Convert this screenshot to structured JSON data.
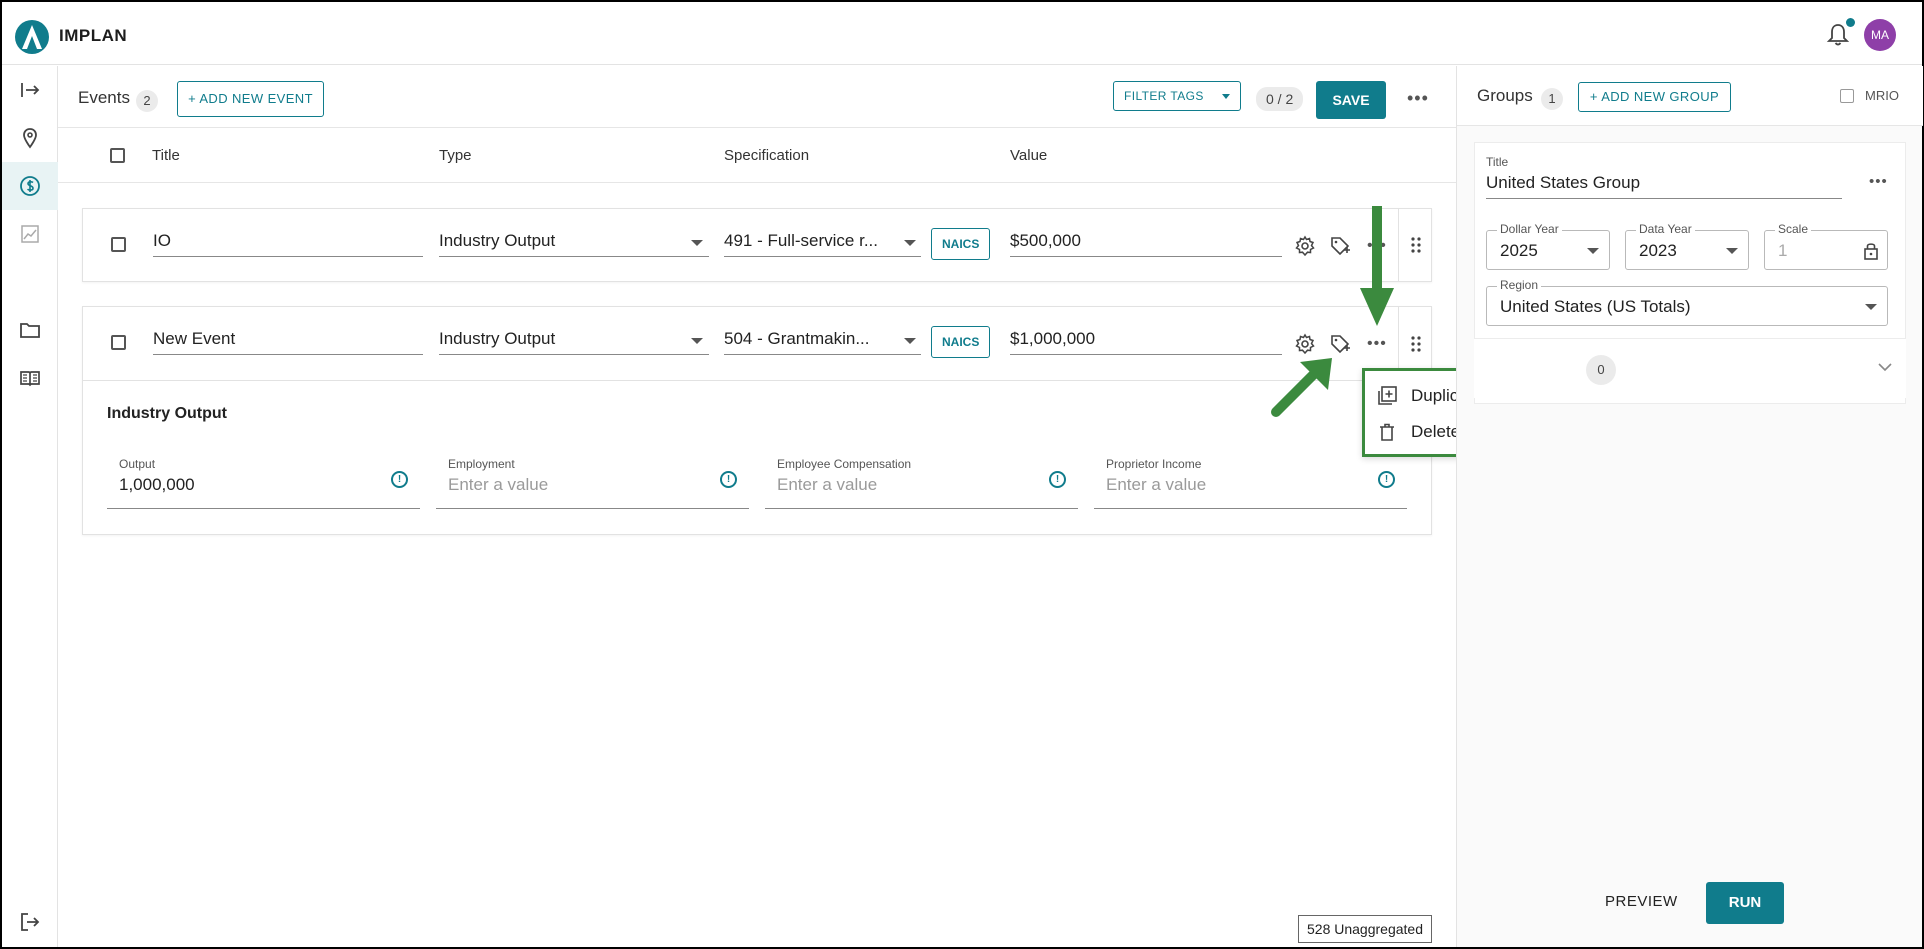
{
  "app": {
    "title": "IMPLAN"
  },
  "user": {
    "initials": "MA"
  },
  "events": {
    "title": "Events",
    "count": "2",
    "add_label": "+ ADD NEW EVENT",
    "filter_tags_label": "FILTER TAGS",
    "selection_count": "0 / 2",
    "save_label": "SAVE",
    "columns": [
      "Title",
      "Type",
      "Specification",
      "Value"
    ],
    "rows": [
      {
        "title": "IO",
        "type": "Industry Output",
        "specification": "491 - Full-service r...",
        "naics": "NAICS",
        "value": "$500,000"
      },
      {
        "title": "New Event",
        "type": "Industry Output",
        "specification": "504 - Grantmakin...",
        "naics": "NAICS",
        "value": "$1,000,000"
      }
    ],
    "detail": {
      "section_title": "Industry Output",
      "fields": [
        {
          "label": "Output",
          "value": "1,000,000",
          "placeholder": ""
        },
        {
          "label": "Employment",
          "value": "",
          "placeholder": "Enter a value"
        },
        {
          "label": "Employee Compensation",
          "value": "",
          "placeholder": "Enter a value"
        },
        {
          "label": "Proprietor Income",
          "value": "",
          "placeholder": "Enter a value"
        }
      ]
    }
  },
  "context_menu": {
    "items": [
      {
        "label": "Duplicate Event",
        "icon": "duplicate-icon"
      },
      {
        "label": "Delete Event",
        "icon": "trash-icon"
      }
    ]
  },
  "groups": {
    "title": "Groups",
    "count": "1",
    "add_label": "+ ADD NEW GROUP",
    "mrio_label": "MRIO",
    "card": {
      "title_label": "Title",
      "title_value": "United States Group",
      "dollar_year_label": "Dollar Year",
      "dollar_year_value": "2025",
      "data_year_label": "Data Year",
      "data_year_value": "2023",
      "scale_label": "Scale",
      "scale_value": "1",
      "region_label": "Region",
      "region_value": "United States (US Totals)",
      "sub_count": "0"
    }
  },
  "footer": {
    "preview_label": "PREVIEW",
    "run_label": "RUN",
    "status_chip": "528 Unaggregated"
  },
  "colors": {
    "accent": "#107c8c",
    "annotation": "#3b8a3e",
    "avatar": "#8e3fa8"
  }
}
